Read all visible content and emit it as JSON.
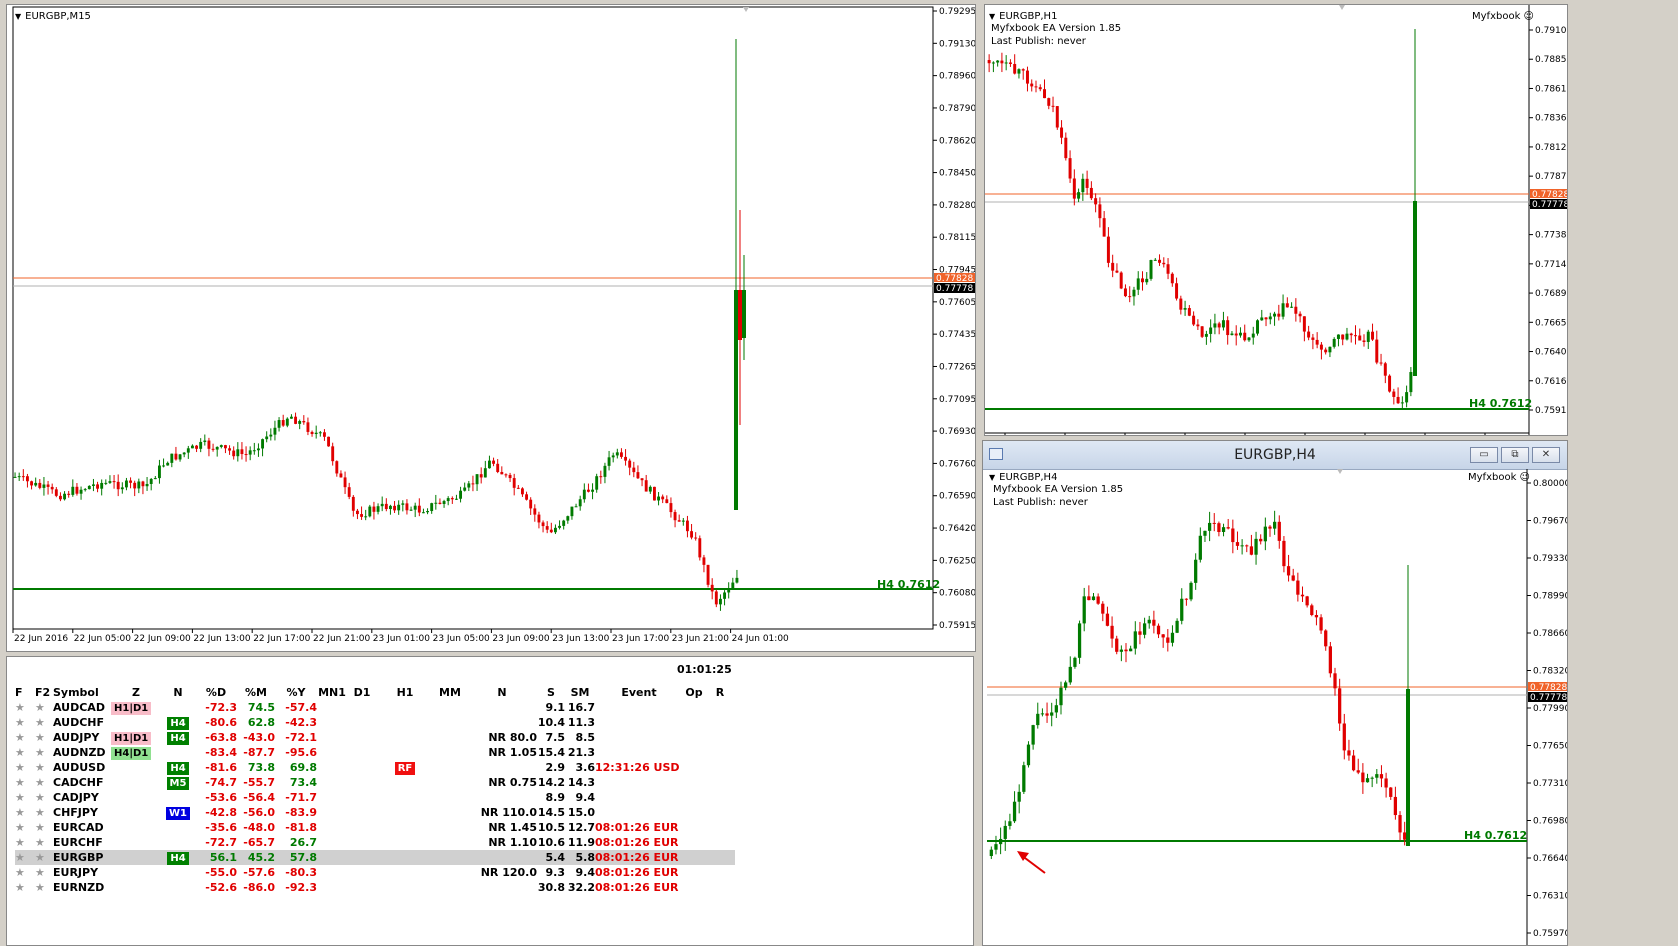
{
  "colors": {
    "bull": "#007a00",
    "bear": "#e00000",
    "hline_orange": "#f0632a",
    "hline_green": "#007a00",
    "bid_box": "#000000",
    "ask_box": "#f0632a"
  },
  "chart_m15": {
    "title": "EURGBP,M15",
    "price_labels": [
      "0.79295",
      "0.79130",
      "0.78960",
      "0.78790",
      "0.78620",
      "0.78450",
      "0.78280",
      "0.78115",
      "0.77945",
      "0.77605",
      "0.77435",
      "0.77265",
      "0.77095",
      "0.76930",
      "0.76760",
      "0.76590",
      "0.76420",
      "0.76250",
      "0.76080",
      "0.75915"
    ],
    "ask_label": "0.77828",
    "bid_label": "0.77778",
    "h4_label": "H4 0.7612",
    "time_labels": [
      "22 Jun 2016",
      "22 Jun 05:00",
      "22 Jun 09:00",
      "22 Jun 13:00",
      "22 Jun 17:00",
      "22 Jun 21:00",
      "23 Jun 01:00",
      "23 Jun 05:00",
      "23 Jun 09:00",
      "23 Jun 13:00",
      "23 Jun 17:00",
      "23 Jun 21:00",
      "24 Jun 01:00"
    ]
  },
  "chart_h1": {
    "title": "EURGBP,H1",
    "brand": "Myfxbook",
    "ea_version": "Myfxbook EA Version 1.85",
    "last_publish": "Last Publish: never",
    "price_labels": [
      "0.79100",
      "0.78855",
      "0.78610",
      "0.78365",
      "0.78120",
      "0.77875",
      "0.77630",
      "0.77385",
      "0.77140",
      "0.76895",
      "0.76650",
      "0.76400",
      "0.76160",
      "0.75915"
    ],
    "ask_label": "0.77828",
    "bid_label": "0.77778",
    "h4_label": "H4 0.7612"
  },
  "chart_h4": {
    "window_title": "EURGBP,H4",
    "title": "EURGBP,H4",
    "brand": "Myfxbook",
    "ea_version": "Myfxbook EA Version 1.85",
    "last_publish": "Last Publish: never",
    "price_labels": [
      "0.80000",
      "0.79670",
      "0.79330",
      "0.78990",
      "0.78660",
      "0.78320",
      "0.77990",
      "0.77650",
      "0.77310",
      "0.76980",
      "0.76640",
      "0.76310",
      "0.75970"
    ],
    "ask_label": "0.77828",
    "bid_label": "0.77778",
    "h4_label": "H4 0.7612"
  },
  "window_buttons": {
    "minimize": "▭",
    "restore": "⧉",
    "close": "✕"
  },
  "symbol_table": {
    "clock": "01:01:25",
    "headers": [
      "F",
      "F2",
      "Symbol",
      "Z",
      "N",
      "%D",
      "%M",
      "%Y",
      "MN1",
      "D1",
      "H1",
      "MM",
      "N",
      "S",
      "SM",
      "Event",
      "Op",
      "R"
    ],
    "rows": [
      {
        "sym": "AUDCAD",
        "z": "H1|D1",
        "zc": "b-pink",
        "n": "",
        "nc": "",
        "d": "-72.3",
        "m": "74.5",
        "y": "-57.4",
        "h1": "",
        "nr": "",
        "s": "9.1",
        "sm": "16.7",
        "ev": ""
      },
      {
        "sym": "AUDCHF",
        "z": "",
        "zc": "",
        "n": "H4",
        "nc": "b-grn",
        "d": "-80.6",
        "m": "62.8",
        "y": "-42.3",
        "h1": "",
        "nr": "",
        "s": "10.4",
        "sm": "11.3",
        "ev": ""
      },
      {
        "sym": "AUDJPY",
        "z": "H1|D1",
        "zc": "b-pink",
        "n": "H4",
        "nc": "b-grn",
        "d": "-63.8",
        "m": "-43.0",
        "y": "-72.1",
        "h1": "",
        "nr": "NR 80.0",
        "s": "7.5",
        "sm": "8.5",
        "ev": ""
      },
      {
        "sym": "AUDNZD",
        "z": "H4|D1",
        "zc": "b-lgrn",
        "n": "",
        "nc": "",
        "d": "-83.4",
        "m": "-87.7",
        "y": "-95.6",
        "h1": "",
        "nr": "NR 1.05",
        "s": "15.4",
        "sm": "21.3",
        "ev": ""
      },
      {
        "sym": "AUDUSD",
        "z": "",
        "zc": "",
        "n": "H4",
        "nc": "b-grn",
        "d": "-81.6",
        "m": "73.8",
        "y": "69.8",
        "h1": "RF",
        "nr": "",
        "s": "2.9",
        "sm": "3.6",
        "ev": "12:31:26 USD"
      },
      {
        "sym": "CADCHF",
        "z": "",
        "zc": "",
        "n": "M5",
        "nc": "b-grn",
        "d": "-74.7",
        "m": "-55.7",
        "y": "73.4",
        "h1": "",
        "nr": "NR 0.75",
        "s": "14.2",
        "sm": "14.3",
        "ev": ""
      },
      {
        "sym": "CADJPY",
        "z": "",
        "zc": "",
        "n": "",
        "nc": "",
        "d": "-53.6",
        "m": "-56.4",
        "y": "-71.7",
        "h1": "",
        "nr": "",
        "s": "8.9",
        "sm": "9.4",
        "ev": ""
      },
      {
        "sym": "CHFJPY",
        "z": "",
        "zc": "",
        "n": "W1",
        "nc": "b-blue",
        "d": "-42.8",
        "m": "-56.0",
        "y": "-83.9",
        "h1": "",
        "nr": "NR 110.0",
        "s": "14.5",
        "sm": "15.0",
        "ev": ""
      },
      {
        "sym": "EURCAD",
        "z": "",
        "zc": "",
        "n": "",
        "nc": "",
        "d": "-35.6",
        "m": "-48.0",
        "y": "-81.8",
        "h1": "",
        "nr": "NR 1.45",
        "s": "10.5",
        "sm": "12.7",
        "ev": "08:01:26 EUR"
      },
      {
        "sym": "EURCHF",
        "z": "",
        "zc": "",
        "n": "",
        "nc": "",
        "d": "-72.7",
        "m": "-65.7",
        "y": "26.7",
        "h1": "",
        "nr": "NR 1.10",
        "s": "10.6",
        "sm": "11.9",
        "ev": "08:01:26 EUR"
      },
      {
        "sym": "EURGBP",
        "z": "",
        "zc": "",
        "n": "H4",
        "nc": "b-grn",
        "d": "56.1",
        "m": "45.2",
        "y": "57.8",
        "h1": "",
        "nr": "",
        "s": "5.4",
        "sm": "5.8",
        "ev": "08:01:26 EUR",
        "sel": true
      },
      {
        "sym": "EURJPY",
        "z": "",
        "zc": "",
        "n": "",
        "nc": "",
        "d": "-55.0",
        "m": "-57.6",
        "y": "-80.3",
        "h1": "",
        "nr": "NR 120.0",
        "s": "9.3",
        "sm": "9.4",
        "ev": "08:01:26 EUR"
      },
      {
        "sym": "EURNZD",
        "z": "",
        "zc": "",
        "n": "",
        "nc": "",
        "d": "-52.6",
        "m": "-86.0",
        "y": "-92.3",
        "h1": "",
        "nr": "",
        "s": "30.8",
        "sm": "32.2",
        "ev": "08:01:26 EUR"
      }
    ]
  }
}
